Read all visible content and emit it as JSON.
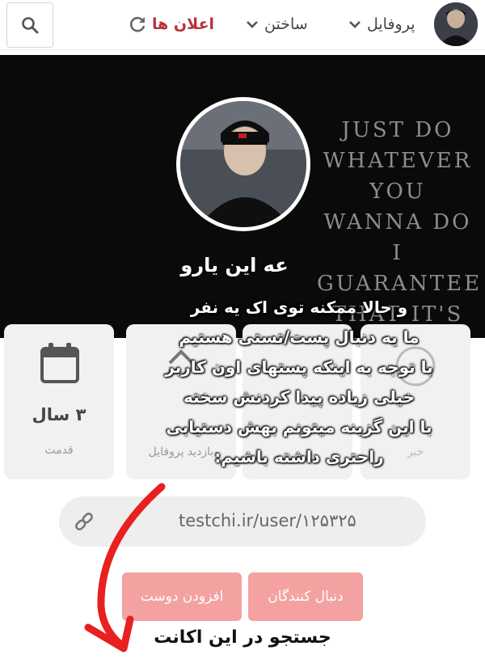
{
  "nav": {
    "search_icon": "search-icon",
    "announcements": "اعلان ها",
    "build": "ساختن",
    "profile": "پروفایل"
  },
  "banner": {
    "quote": "JUST DO\nWHATEVER YOU\nWANNA DO\nI GUARANTEE\nTHAT IT'S THE\nBEST FOR YOU",
    "name": "عه این یارو"
  },
  "cards": {
    "age_value": "۳ سال",
    "age_caption": "قدمت",
    "card2_caption": "بازدید پروفایل",
    "card4_caption": "خبر"
  },
  "overlay_note": "و حالا ممکنه توی اک یه نفر\nما یه دنبال پست/تستی هستیم\nبا توجه به اینکه پستهای اون کاربر\nخیلی زیاده پیدا کردنش سخته\nبا این گزینه میتونم بهش دستیابی\nراحتری داشته باشیم:",
  "profile_link": "testchi.ir/user/۱۲۵۳۲۵",
  "buttons": {
    "add_friend": "افزودن دوست",
    "followers": "دنبال کنندگان"
  },
  "search_account": "جستجو در این اکانت",
  "colors": {
    "accent_red": "#b8323a",
    "button_pink": "#f4a1a1",
    "arrow_red": "#e8201f"
  }
}
